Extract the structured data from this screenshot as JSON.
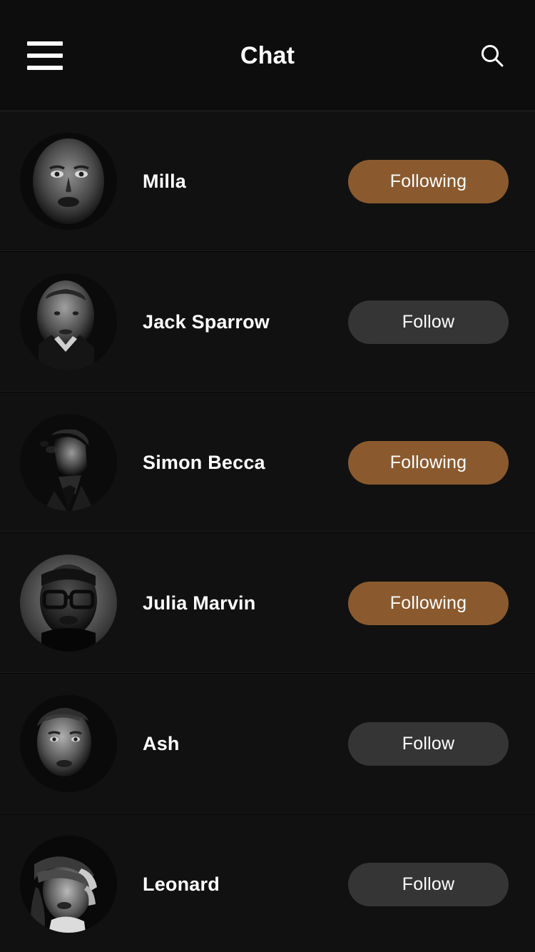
{
  "header": {
    "title": "Chat",
    "menu_icon": "hamburger-menu-icon",
    "search_icon": "search-icon"
  },
  "theme": {
    "page_background": "#0d0d0d",
    "row_background": "#111111",
    "row_divider": "#1b1b1b",
    "text_primary": "#ffffff",
    "accent_following": "#8a5a2e",
    "neutral_follow": "#353535"
  },
  "labels": {
    "following": "Following",
    "follow": "Follow"
  },
  "list": {
    "rows": [
      {
        "name": "Milla",
        "button_label": "Following",
        "state": "following",
        "avatar": "woman-portrait-avatar"
      },
      {
        "name": "Jack Sparrow",
        "button_label": "Follow",
        "state": "follow",
        "avatar": "man-suit-avatar"
      },
      {
        "name": "Simon Becca",
        "button_label": "Following",
        "state": "following",
        "avatar": "man-smoking-avatar"
      },
      {
        "name": "Julia Marvin",
        "button_label": "Following",
        "state": "following",
        "avatar": "man-glasses-avatar"
      },
      {
        "name": "Ash",
        "button_label": "Follow",
        "state": "follow",
        "avatar": "woman-short-hair-avatar"
      },
      {
        "name": "Leonard",
        "button_label": "Follow",
        "state": "follow",
        "avatar": "woman-hair-over-face-avatar"
      }
    ]
  }
}
